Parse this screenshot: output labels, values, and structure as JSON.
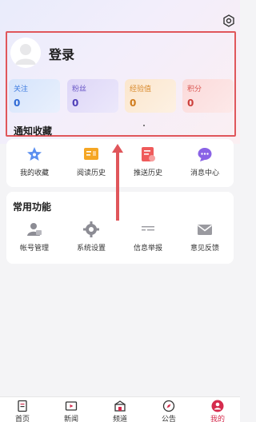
{
  "profile": {
    "login_label": "登录",
    "stats": [
      {
        "label": "关注",
        "value": "0"
      },
      {
        "label": "粉丝",
        "value": "0"
      },
      {
        "label": "经验值",
        "value": "0"
      },
      {
        "label": "积分",
        "value": "0"
      }
    ],
    "section_title": "通知收藏"
  },
  "notify_items": [
    {
      "label": "我的收藏",
      "icon": "star-icon"
    },
    {
      "label": "阅读历史",
      "icon": "reading-history-icon"
    },
    {
      "label": "推送历史",
      "icon": "push-history-icon"
    },
    {
      "label": "消息中心",
      "icon": "message-icon"
    }
  ],
  "common": {
    "title": "常用功能",
    "items": [
      {
        "label": "帐号管理",
        "icon": "account-icon"
      },
      {
        "label": "系统设置",
        "icon": "gear-icon"
      },
      {
        "label": "信息举报",
        "icon": "report-icon"
      },
      {
        "label": "意见反馈",
        "icon": "mail-icon"
      }
    ]
  },
  "tabs": [
    {
      "label": "首页",
      "icon": "home-icon"
    },
    {
      "label": "新闻",
      "icon": "video-icon"
    },
    {
      "label": "频道",
      "icon": "channel-icon"
    },
    {
      "label": "公告",
      "icon": "compass-icon"
    },
    {
      "label": "我的",
      "icon": "user-icon",
      "active": true
    }
  ],
  "colors": {
    "accent": "#d52b4d",
    "highlight_border": "#e0565b"
  }
}
